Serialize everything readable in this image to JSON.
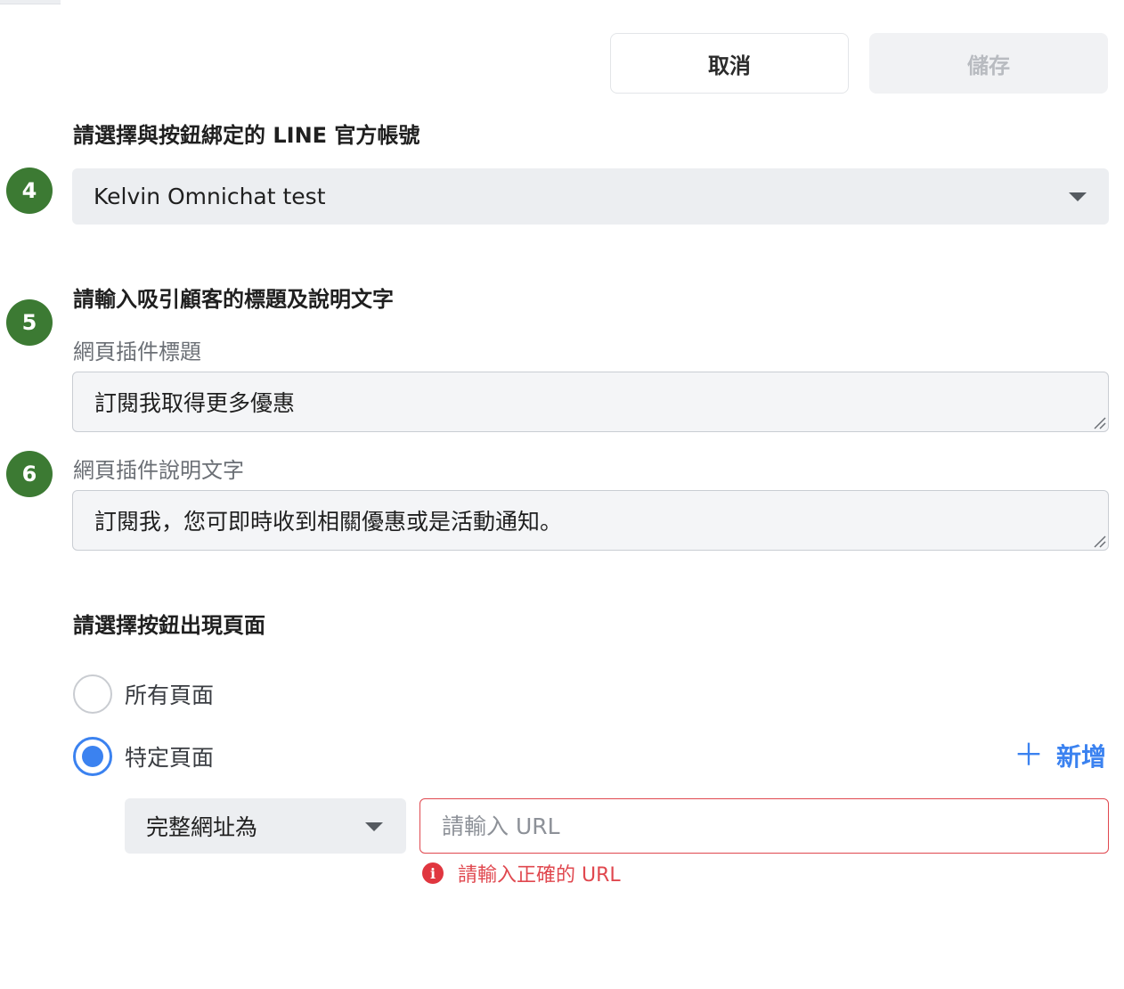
{
  "toolbar": {
    "cancel_label": "取消",
    "save_label": "儲存"
  },
  "account_section": {
    "title": "請選擇與按鈕綁定的 LINE 官方帳號",
    "step": "4",
    "selected_account": "Kelvin Omnichat test"
  },
  "copy_section": {
    "title": "請輸入吸引顧客的標題及說明文字",
    "step_title": "5",
    "step_description": "6",
    "widget_title_label": "網頁插件標題",
    "widget_title_value": "訂閱我取得更多優惠",
    "widget_description_label": "網頁插件說明文字",
    "widget_description_value": "訂閱我，您可即時收到相關優惠或是活動通知。"
  },
  "page_section": {
    "title": "請選擇按鈕出現頁面",
    "options": [
      {
        "label": "所有頁面",
        "checked": false
      },
      {
        "label": "特定頁面",
        "checked": true
      }
    ],
    "add_label": "新增",
    "add_icon": "plus-icon",
    "match_type": "完整網址為",
    "url_placeholder": "請輸入 URL",
    "url_value": "",
    "error_message": "請輸入正確的 URL"
  },
  "colors": {
    "accent": "#3b82f0",
    "step_badge": "#3c7a33",
    "error": "#e0484f"
  }
}
